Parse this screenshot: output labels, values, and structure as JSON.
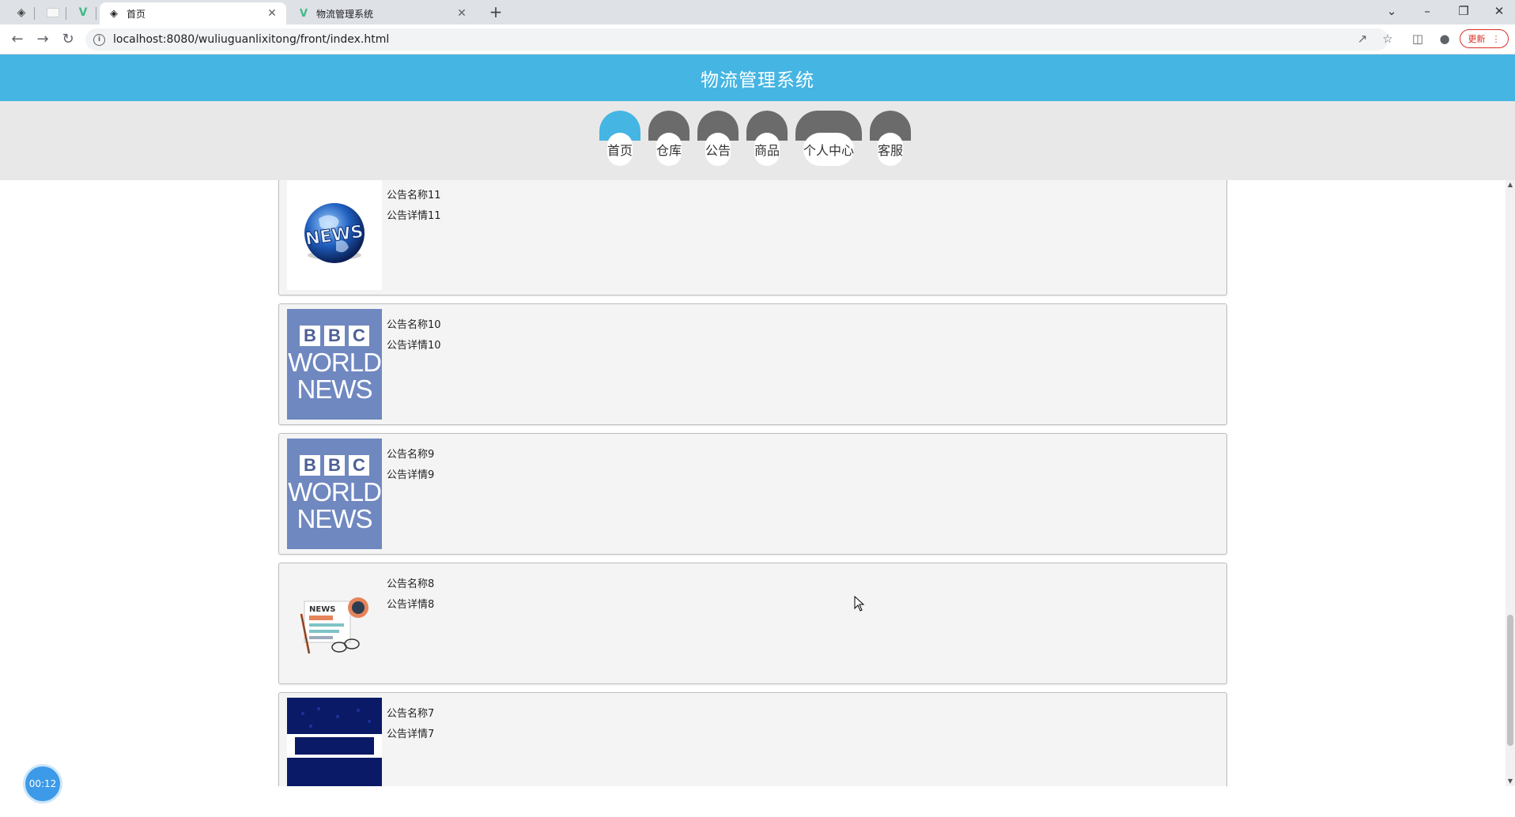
{
  "browser": {
    "tabs": [
      {
        "title": "首页",
        "favicon": "globe-icon",
        "active": true
      },
      {
        "title": "物流管理系统",
        "favicon": "vue-logo-icon",
        "active": false
      }
    ],
    "url": "localhost:8080/wuliuguanlixitong/front/index.html",
    "update_label": "更新"
  },
  "site": {
    "title": "物流管理系统",
    "nav": [
      {
        "label": "首页",
        "active": true
      },
      {
        "label": "仓库",
        "active": false
      },
      {
        "label": "公告",
        "active": false
      },
      {
        "label": "商品",
        "active": false
      },
      {
        "label": "个人中心",
        "active": false
      },
      {
        "label": "客服",
        "active": false
      }
    ]
  },
  "notices": [
    {
      "name": "公告名称11",
      "detail": "公告详情11",
      "image": "globe-news"
    },
    {
      "name": "公告名称10",
      "detail": "公告详情10",
      "image": "bbc-world-news"
    },
    {
      "name": "公告名称9",
      "detail": "公告详情9",
      "image": "bbc-world-news"
    },
    {
      "name": "公告名称8",
      "detail": "公告详情8",
      "image": "newspaper-illustration"
    },
    {
      "name": "公告名称7",
      "detail": "公告详情7",
      "image": "blue-news-banner"
    }
  ],
  "bbc_logo": {
    "letters": [
      "B",
      "B",
      "C"
    ],
    "line1": "WORLD",
    "line2": "NEWS"
  },
  "timer": "00:12",
  "colors": {
    "header": "#45b5e3",
    "nav_cap": "#6b6b6b",
    "nav_active": "#45b5e3"
  }
}
